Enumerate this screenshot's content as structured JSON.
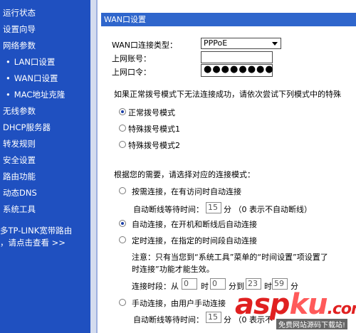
{
  "sidebar": {
    "items": [
      {
        "label": "运行状态",
        "sub": false
      },
      {
        "label": "设置向导",
        "sub": false
      },
      {
        "label": "网络参数",
        "sub": false
      },
      {
        "label": "LAN口设置",
        "sub": true
      },
      {
        "label": "WAN口设置",
        "sub": true
      },
      {
        "label": "MAC地址克隆",
        "sub": true
      },
      {
        "label": "无线参数",
        "sub": false
      },
      {
        "label": "DHCP服务器",
        "sub": false
      },
      {
        "label": "转发规则",
        "sub": false
      },
      {
        "label": "安全设置",
        "sub": false
      },
      {
        "label": "路由功能",
        "sub": false
      },
      {
        "label": "动态DNS",
        "sub": false
      },
      {
        "label": "系统工具",
        "sub": false
      }
    ],
    "promo_line1": "多TP-LINK宽带路由",
    "promo_line2": "，请点击查看 >>"
  },
  "header": {
    "title": "WAN口设置"
  },
  "form": {
    "conn_type_label": "WAN口连接类型：",
    "conn_type_value": "PPPoE",
    "account_label": "上网账号：",
    "account_value": "",
    "password_label": "上网口令：",
    "password_value": "●●●●●●●●",
    "dial_hint": "如果正常拨号模式下无法连接成功，请依次尝试下列模式中的特殊",
    "dial_modes": [
      "正常拨号模式",
      "特殊拨号模式1",
      "特殊拨号模式2"
    ],
    "dial_selected": 0,
    "connect_hint": "根据您的需要，请选择对应的连接模式：",
    "on_demand_label": "按需连接，在有访问时自动连接",
    "on_demand_idle_prefix": "自动断线等待时间：",
    "on_demand_idle_value": "15",
    "on_demand_idle_suffix": "分 （0 表示不自动断线）",
    "auto_label": "自动连接，在开机和断线后自动连接",
    "timed_label": "定时连接，在指定的时间段自动连接",
    "timed_note1": "注意：只有当您到“系统工具”菜单的“时间设置”项设置了",
    "timed_note2": "时连接”功能才能生效。",
    "period_prefix": "连接时段：从",
    "period_from_h": "0",
    "period_h1": "时",
    "period_from_m": "0",
    "period_mid": "分到",
    "period_to_h": "23",
    "period_h2": "时",
    "period_to_m": "59",
    "period_suffix": "分",
    "manual_label": "手动连接，由用户手动连接",
    "manual_idle_prefix": "自动断线等待时间：",
    "manual_idle_value": "15",
    "manual_idle_suffix": "分 （0 表示不",
    "conn_selected": 1
  },
  "watermark": {
    "asp": "asp",
    "ku": "ku",
    "com": ".com",
    "sub": "免费网站源码下载站!"
  },
  "colors": {
    "sidebar": "#1f50c0",
    "header": "#2f66cc",
    "watermark": "#e02020"
  }
}
